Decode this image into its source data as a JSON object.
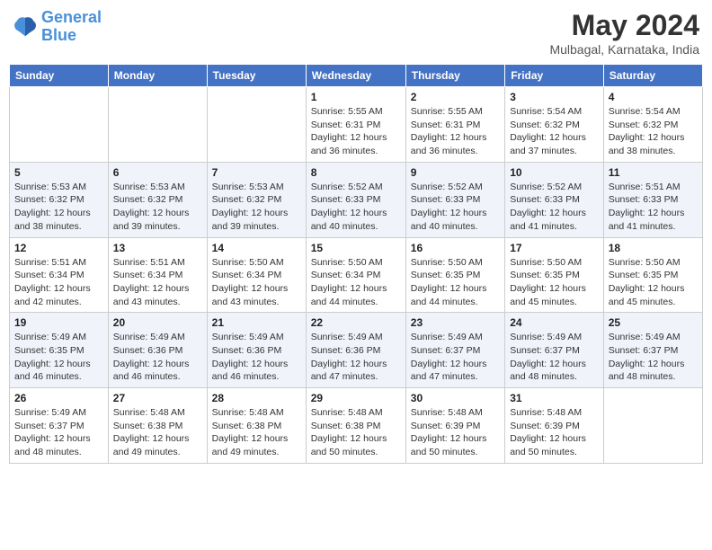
{
  "logo": {
    "line1": "General",
    "line2": "Blue"
  },
  "title": "May 2024",
  "subtitle": "Mulbagal, Karnataka, India",
  "days_of_week": [
    "Sunday",
    "Monday",
    "Tuesday",
    "Wednesday",
    "Thursday",
    "Friday",
    "Saturday"
  ],
  "weeks": [
    [
      {
        "day": "",
        "info": ""
      },
      {
        "day": "",
        "info": ""
      },
      {
        "day": "",
        "info": ""
      },
      {
        "day": "1",
        "info": "Sunrise: 5:55 AM\nSunset: 6:31 PM\nDaylight: 12 hours and 36 minutes."
      },
      {
        "day": "2",
        "info": "Sunrise: 5:55 AM\nSunset: 6:31 PM\nDaylight: 12 hours and 36 minutes."
      },
      {
        "day": "3",
        "info": "Sunrise: 5:54 AM\nSunset: 6:32 PM\nDaylight: 12 hours and 37 minutes."
      },
      {
        "day": "4",
        "info": "Sunrise: 5:54 AM\nSunset: 6:32 PM\nDaylight: 12 hours and 38 minutes."
      }
    ],
    [
      {
        "day": "5",
        "info": "Sunrise: 5:53 AM\nSunset: 6:32 PM\nDaylight: 12 hours and 38 minutes."
      },
      {
        "day": "6",
        "info": "Sunrise: 5:53 AM\nSunset: 6:32 PM\nDaylight: 12 hours and 39 minutes."
      },
      {
        "day": "7",
        "info": "Sunrise: 5:53 AM\nSunset: 6:32 PM\nDaylight: 12 hours and 39 minutes."
      },
      {
        "day": "8",
        "info": "Sunrise: 5:52 AM\nSunset: 6:33 PM\nDaylight: 12 hours and 40 minutes."
      },
      {
        "day": "9",
        "info": "Sunrise: 5:52 AM\nSunset: 6:33 PM\nDaylight: 12 hours and 40 minutes."
      },
      {
        "day": "10",
        "info": "Sunrise: 5:52 AM\nSunset: 6:33 PM\nDaylight: 12 hours and 41 minutes."
      },
      {
        "day": "11",
        "info": "Sunrise: 5:51 AM\nSunset: 6:33 PM\nDaylight: 12 hours and 41 minutes."
      }
    ],
    [
      {
        "day": "12",
        "info": "Sunrise: 5:51 AM\nSunset: 6:34 PM\nDaylight: 12 hours and 42 minutes."
      },
      {
        "day": "13",
        "info": "Sunrise: 5:51 AM\nSunset: 6:34 PM\nDaylight: 12 hours and 43 minutes."
      },
      {
        "day": "14",
        "info": "Sunrise: 5:50 AM\nSunset: 6:34 PM\nDaylight: 12 hours and 43 minutes."
      },
      {
        "day": "15",
        "info": "Sunrise: 5:50 AM\nSunset: 6:34 PM\nDaylight: 12 hours and 44 minutes."
      },
      {
        "day": "16",
        "info": "Sunrise: 5:50 AM\nSunset: 6:35 PM\nDaylight: 12 hours and 44 minutes."
      },
      {
        "day": "17",
        "info": "Sunrise: 5:50 AM\nSunset: 6:35 PM\nDaylight: 12 hours and 45 minutes."
      },
      {
        "day": "18",
        "info": "Sunrise: 5:50 AM\nSunset: 6:35 PM\nDaylight: 12 hours and 45 minutes."
      }
    ],
    [
      {
        "day": "19",
        "info": "Sunrise: 5:49 AM\nSunset: 6:35 PM\nDaylight: 12 hours and 46 minutes."
      },
      {
        "day": "20",
        "info": "Sunrise: 5:49 AM\nSunset: 6:36 PM\nDaylight: 12 hours and 46 minutes."
      },
      {
        "day": "21",
        "info": "Sunrise: 5:49 AM\nSunset: 6:36 PM\nDaylight: 12 hours and 46 minutes."
      },
      {
        "day": "22",
        "info": "Sunrise: 5:49 AM\nSunset: 6:36 PM\nDaylight: 12 hours and 47 minutes."
      },
      {
        "day": "23",
        "info": "Sunrise: 5:49 AM\nSunset: 6:37 PM\nDaylight: 12 hours and 47 minutes."
      },
      {
        "day": "24",
        "info": "Sunrise: 5:49 AM\nSunset: 6:37 PM\nDaylight: 12 hours and 48 minutes."
      },
      {
        "day": "25",
        "info": "Sunrise: 5:49 AM\nSunset: 6:37 PM\nDaylight: 12 hours and 48 minutes."
      }
    ],
    [
      {
        "day": "26",
        "info": "Sunrise: 5:49 AM\nSunset: 6:37 PM\nDaylight: 12 hours and 48 minutes."
      },
      {
        "day": "27",
        "info": "Sunrise: 5:48 AM\nSunset: 6:38 PM\nDaylight: 12 hours and 49 minutes."
      },
      {
        "day": "28",
        "info": "Sunrise: 5:48 AM\nSunset: 6:38 PM\nDaylight: 12 hours and 49 minutes."
      },
      {
        "day": "29",
        "info": "Sunrise: 5:48 AM\nSunset: 6:38 PM\nDaylight: 12 hours and 50 minutes."
      },
      {
        "day": "30",
        "info": "Sunrise: 5:48 AM\nSunset: 6:39 PM\nDaylight: 12 hours and 50 minutes."
      },
      {
        "day": "31",
        "info": "Sunrise: 5:48 AM\nSunset: 6:39 PM\nDaylight: 12 hours and 50 minutes."
      },
      {
        "day": "",
        "info": ""
      }
    ]
  ]
}
